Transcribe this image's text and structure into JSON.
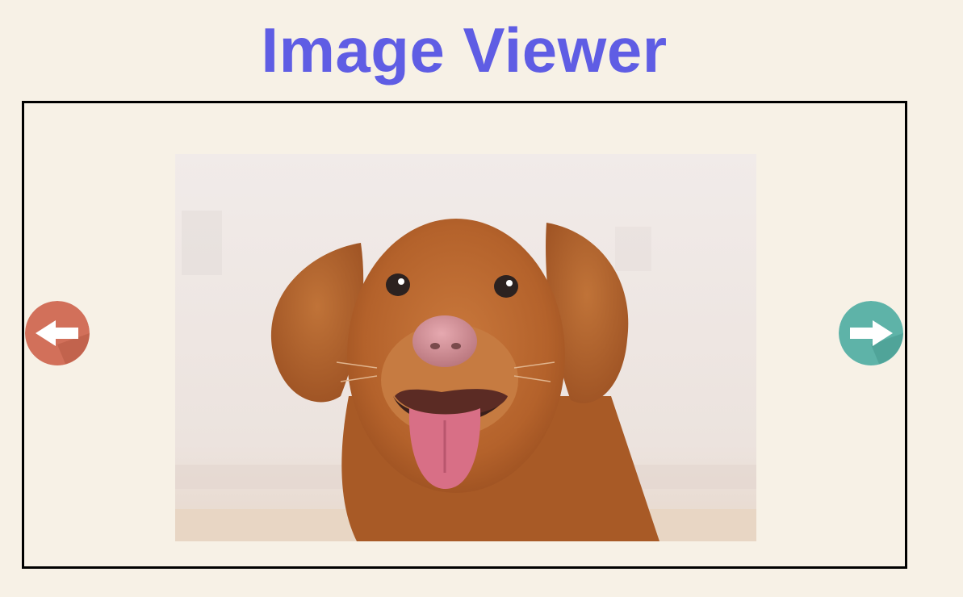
{
  "page": {
    "title": "Image Viewer"
  },
  "viewer": {
    "image_subject": "dog",
    "prev_button": {
      "icon": "arrow-left-icon",
      "color": "#d2705a"
    },
    "next_button": {
      "icon": "arrow-right-icon",
      "color": "#5eb3a8"
    }
  },
  "colors": {
    "background": "#f7f1e6",
    "title": "#5f5de4",
    "frame_border": "#000000"
  }
}
